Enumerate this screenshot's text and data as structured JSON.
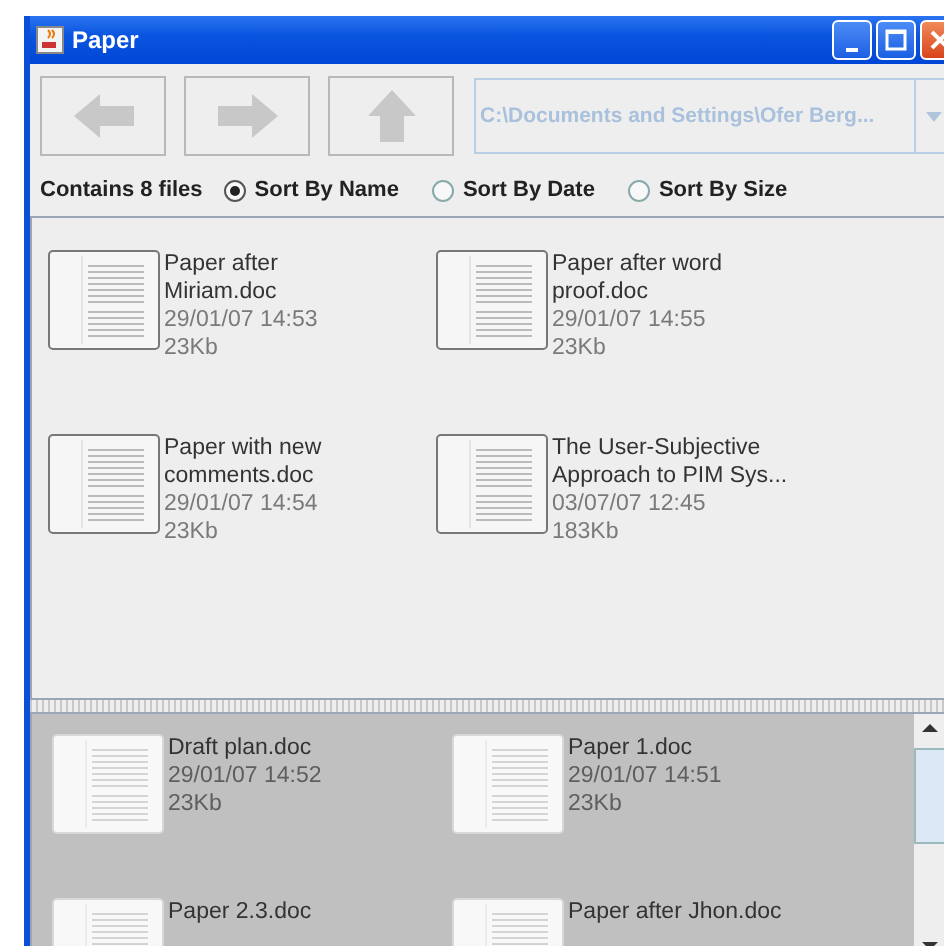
{
  "window": {
    "title": "Paper"
  },
  "toolbar": {
    "path": "C:\\Documents and Settings\\Ofer Berg..."
  },
  "summary": "Contains 8 files",
  "sort_options": [
    {
      "label": "Sort By Name",
      "selected": true
    },
    {
      "label": "Sort By Date",
      "selected": false
    },
    {
      "label": "Sort By Size",
      "selected": false
    }
  ],
  "top_files": [
    {
      "name_lines": [
        "Paper after",
        "Miriam.doc"
      ],
      "date": "29/01/07 14:53",
      "size": "23Kb"
    },
    {
      "name_lines": [
        "Paper after word",
        "proof.doc"
      ],
      "date": "29/01/07 14:55",
      "size": "23Kb"
    },
    {
      "name_lines": [
        "Paper with new",
        "comments.doc"
      ],
      "date": "29/01/07 14:54",
      "size": "23Kb"
    },
    {
      "name_lines": [
        "The User-Subjective",
        "Approach to PIM Sys..."
      ],
      "date": "03/07/07 12:45",
      "size": "183Kb"
    }
  ],
  "bottom_files": [
    {
      "name_lines": [
        "Draft plan.doc"
      ],
      "date": "29/01/07 14:52",
      "size": "23Kb"
    },
    {
      "name_lines": [
        "Paper 1.doc"
      ],
      "date": "29/01/07 14:51",
      "size": "23Kb"
    },
    {
      "name_lines": [
        "Paper 2.3.doc"
      ]
    },
    {
      "name_lines": [
        "Paper after Jhon.doc"
      ]
    }
  ]
}
